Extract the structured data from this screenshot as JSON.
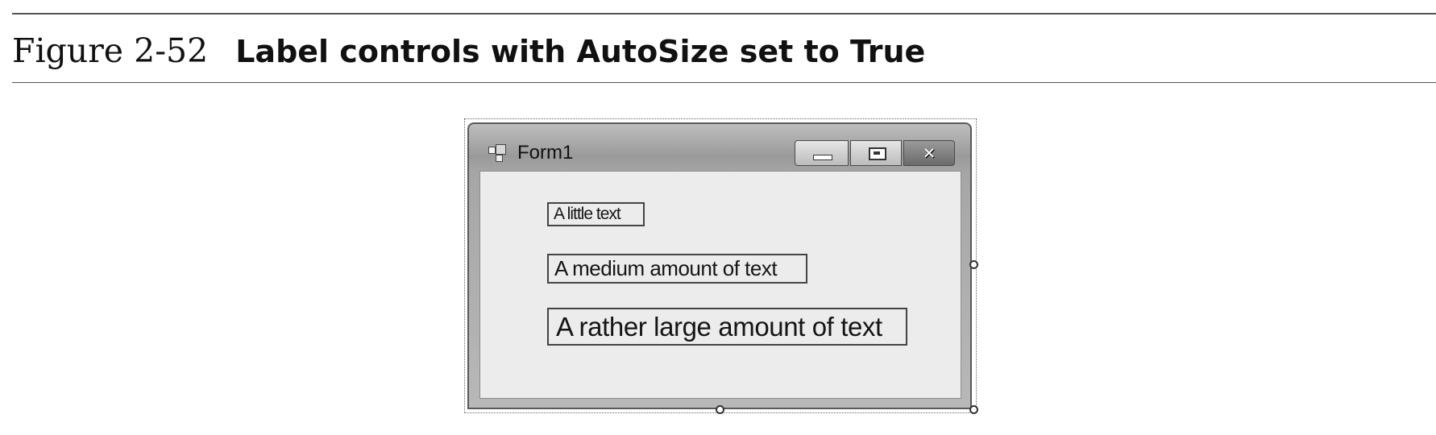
{
  "figure": {
    "number": "Figure 2-52",
    "title": "Label controls with AutoSize set to True"
  },
  "window": {
    "title": "Form1",
    "icon": "form-app-icon",
    "buttons": {
      "minimize_icon": "minimize-icon",
      "maximize_icon": "maximize-icon",
      "close_glyph": "✕"
    }
  },
  "labels": [
    {
      "text": "A little text"
    },
    {
      "text": "A medium amount of text"
    },
    {
      "text": "A rather large amount of text"
    }
  ],
  "colors": {
    "client_background": "#ececec",
    "window_frame": "#a6a6a6"
  }
}
